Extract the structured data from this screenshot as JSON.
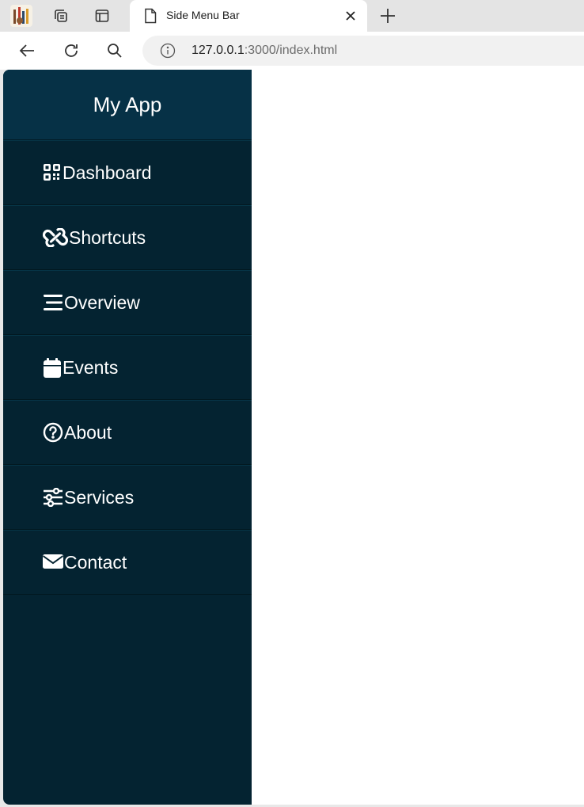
{
  "browser": {
    "tab_title": "Side Menu Bar",
    "url_host": "127.0.0.1",
    "url_rest": ":3000/index.html"
  },
  "app": {
    "title": "My App",
    "menu": [
      {
        "label": "Dashboard",
        "icon": "dashboard-icon"
      },
      {
        "label": "Shortcuts",
        "icon": "link-icon"
      },
      {
        "label": "Overview",
        "icon": "stream-icon"
      },
      {
        "label": "Events",
        "icon": "calendar-icon"
      },
      {
        "label": "About",
        "icon": "question-circle-icon"
      },
      {
        "label": "Services",
        "icon": "sliders-icon"
      },
      {
        "label": "Contact",
        "icon": "envelope-icon"
      }
    ]
  },
  "colors": {
    "sidebar_bg": "#042331",
    "sidebar_header_bg": "#063146",
    "menu_text": "#ffffff"
  }
}
